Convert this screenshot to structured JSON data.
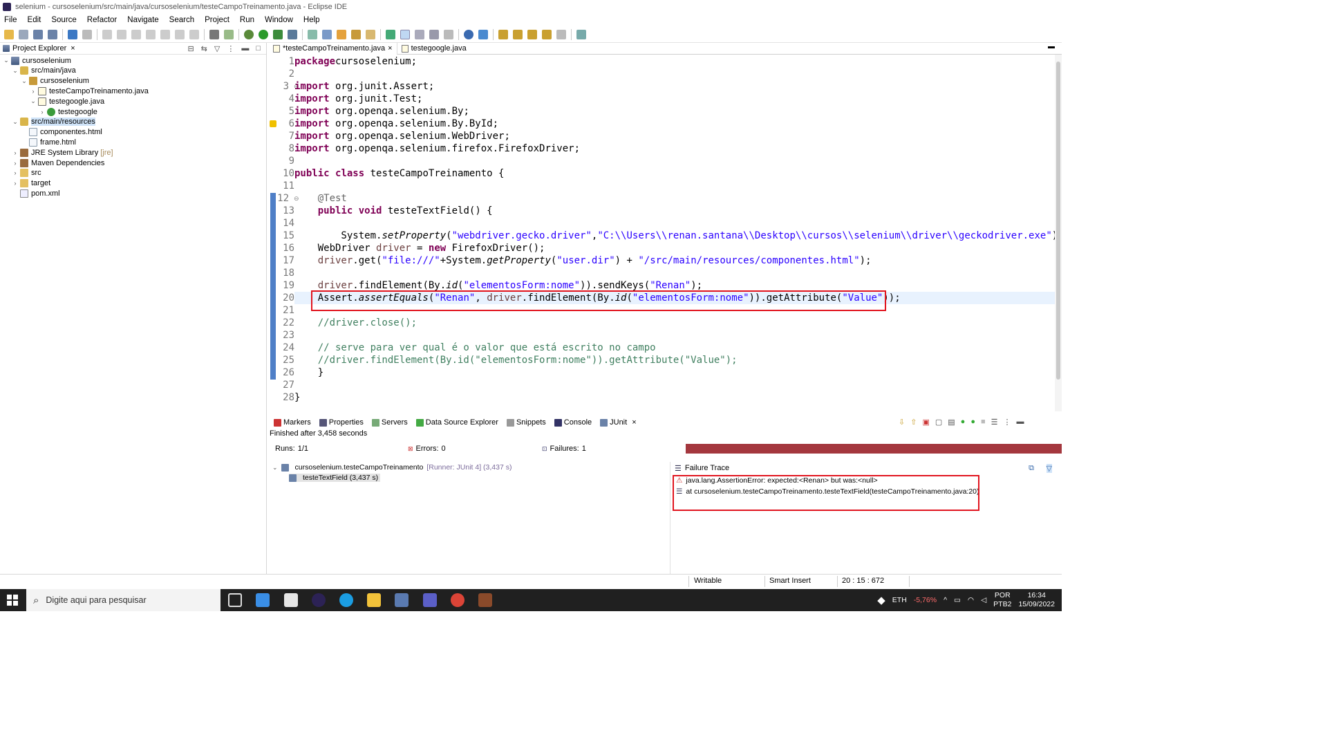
{
  "window": {
    "title": "selenium - cursoselenium/src/main/java/cursoselenium/testeCampoTreinamento.java - Eclipse IDE",
    "minimize": "—",
    "restore": "❐"
  },
  "menu": [
    "File",
    "Edit",
    "Source",
    "Refactor",
    "Navigate",
    "Search",
    "Project",
    "Run",
    "Window",
    "Help"
  ],
  "project_explorer": {
    "title": "Project Explorer",
    "items": [
      {
        "label": "cursoselenium",
        "depth": 0,
        "twisty": "⌄",
        "icon": "project-icon"
      },
      {
        "label": "src/main/java",
        "depth": 1,
        "twisty": "⌄",
        "icon": "source-folder-icon"
      },
      {
        "label": "cursoselenium",
        "depth": 2,
        "twisty": "⌄",
        "icon": "package-icon"
      },
      {
        "label": "testeCampoTreinamento.java",
        "depth": 3,
        "twisty": "›",
        "icon": "java-file-icon"
      },
      {
        "label": "testegoogle.java",
        "depth": 3,
        "twisty": "⌄",
        "icon": "java-file-icon"
      },
      {
        "label": "testegoogle",
        "depth": 4,
        "twisty": "›",
        "icon": "class-icon"
      },
      {
        "label": "src/main/resources",
        "depth": 1,
        "twisty": "⌄",
        "icon": "source-folder-icon",
        "selected": true
      },
      {
        "label": "componentes.html",
        "depth": 2,
        "twisty": "",
        "icon": "html-file-icon"
      },
      {
        "label": "frame.html",
        "depth": 2,
        "twisty": "",
        "icon": "html-file-icon"
      },
      {
        "label": "JRE System Library",
        "suffix": "[jre]",
        "depth": 1,
        "twisty": "›",
        "icon": "library-icon"
      },
      {
        "label": "Maven Dependencies",
        "depth": 1,
        "twisty": "›",
        "icon": "library-icon"
      },
      {
        "label": "src",
        "depth": 1,
        "twisty": "›",
        "icon": "folder-icon"
      },
      {
        "label": "target",
        "depth": 1,
        "twisty": "›",
        "icon": "folder-icon"
      },
      {
        "label": "pom.xml",
        "depth": 1,
        "twisty": "",
        "icon": "xml-file-icon"
      }
    ]
  },
  "editor": {
    "tabs": [
      {
        "label": "*testeCampoTreinamento.java",
        "active": true,
        "close": "×"
      },
      {
        "label": "testegoogle.java",
        "active": false
      }
    ],
    "lines": [
      {
        "n": "1",
        "html": [
          [
            "kw",
            "package"
          ],
          [
            "",
            "cursoselenium;"
          ]
        ]
      },
      {
        "n": "2",
        "html": []
      },
      {
        "n": "3",
        "html": [
          [
            "kw",
            "import"
          ],
          [
            "",
            " org.junit.Assert;"
          ]
        ],
        "fold": "⊖"
      },
      {
        "n": "4",
        "html": [
          [
            "kw",
            "import"
          ],
          [
            "",
            " org.junit.Test;"
          ]
        ]
      },
      {
        "n": "5",
        "html": [
          [
            "kw",
            "import"
          ],
          [
            "",
            " org.openqa.selenium.By;"
          ]
        ]
      },
      {
        "n": "6",
        "html": [
          [
            "kw",
            "import"
          ],
          [
            "",
            " org.openqa.selenium.By.ById;"
          ]
        ],
        "warn": true
      },
      {
        "n": "7",
        "html": [
          [
            "kw",
            "import"
          ],
          [
            "",
            " org.openqa.selenium.WebDriver;"
          ]
        ]
      },
      {
        "n": "8",
        "html": [
          [
            "kw",
            "import"
          ],
          [
            "",
            " org.openqa.selenium.firefox.FirefoxDriver;"
          ]
        ]
      },
      {
        "n": "9",
        "html": []
      },
      {
        "n": "10",
        "html": [
          [
            "kw",
            "public"
          ],
          [
            "",
            " "
          ],
          [
            "kw",
            "class"
          ],
          [
            "",
            " testeCampoTreinamento {"
          ]
        ]
      },
      {
        "n": "11",
        "html": []
      },
      {
        "n": "12",
        "html": [
          [
            "",
            "    "
          ],
          [
            "ann",
            "@Test"
          ]
        ],
        "fold": "⊖"
      },
      {
        "n": "13",
        "html": [
          [
            "",
            "    "
          ],
          [
            "kw",
            "public"
          ],
          [
            "",
            " "
          ],
          [
            "kw",
            "void"
          ],
          [
            "",
            " testeTextField() {"
          ]
        ]
      },
      {
        "n": "14",
        "html": []
      },
      {
        "n": "15",
        "html": [
          [
            "",
            "        System."
          ],
          [
            "it",
            "setProperty"
          ],
          [
            "",
            "("
          ],
          [
            "str",
            "\"webdriver.gecko.driver\""
          ],
          [
            "",
            ","
          ],
          [
            "str",
            "\"C:\\\\Users\\\\renan.santana\\\\Desktop\\\\cursos\\\\selenium\\\\driver\\\\geckodriver.exe\""
          ],
          [
            "",
            ");"
          ]
        ]
      },
      {
        "n": "16",
        "html": [
          [
            "",
            "    WebDriver "
          ],
          [
            "var",
            "driver"
          ],
          [
            "",
            " = "
          ],
          [
            "kw",
            "new"
          ],
          [
            "",
            " FirefoxDriver();"
          ]
        ]
      },
      {
        "n": "17",
        "html": [
          [
            "",
            "    "
          ],
          [
            "var",
            "driver"
          ],
          [
            "",
            ".get("
          ],
          [
            "str",
            "\"file:///\""
          ],
          [
            "",
            "+System."
          ],
          [
            "it",
            "getProperty"
          ],
          [
            "",
            "("
          ],
          [
            "str",
            "\"user.dir\""
          ],
          [
            "",
            ") + "
          ],
          [
            "str",
            "\"/src/main/resources/componentes.html\""
          ],
          [
            "",
            ");"
          ]
        ]
      },
      {
        "n": "18",
        "html": []
      },
      {
        "n": "19",
        "html": [
          [
            "",
            "    "
          ],
          [
            "var",
            "driver"
          ],
          [
            "",
            ".findElement(By."
          ],
          [
            "it",
            "id"
          ],
          [
            "",
            "("
          ],
          [
            "str",
            "\"elementosForm:nome\""
          ],
          [
            "",
            ")).sendKeys("
          ],
          [
            "str",
            "\"Renan\""
          ],
          [
            "",
            ");"
          ]
        ]
      },
      {
        "n": "20",
        "html": [
          [
            "",
            "    Assert."
          ],
          [
            "it",
            "assertEquals"
          ],
          [
            "",
            "("
          ],
          [
            "str",
            "\"Renan\""
          ],
          [
            "",
            ", "
          ],
          [
            "var",
            "driver"
          ],
          [
            "",
            ".findElement(By."
          ],
          [
            "it",
            "id"
          ],
          [
            "",
            "("
          ],
          [
            "str",
            "\"elementosForm:nome\""
          ],
          [
            "",
            ")).getAttribute("
          ],
          [
            "str",
            "\"Value\""
          ],
          [
            "",
            "));"
          ]
        ],
        "current": true
      },
      {
        "n": "21",
        "html": []
      },
      {
        "n": "22",
        "html": [
          [
            "",
            "    "
          ],
          [
            "cmt",
            "//driver.close();"
          ]
        ]
      },
      {
        "n": "23",
        "html": []
      },
      {
        "n": "24",
        "html": [
          [
            "",
            "    "
          ],
          [
            "cmt",
            "// serve para ver qual é o valor que está escrito no campo"
          ]
        ]
      },
      {
        "n": "25",
        "html": [
          [
            "",
            "    "
          ],
          [
            "cmt",
            "//driver.findElement(By.id(\"elementosForm:nome\")).getAttribute(\"Value\");"
          ]
        ]
      },
      {
        "n": "26",
        "html": [
          [
            "",
            "    }"
          ]
        ]
      },
      {
        "n": "27",
        "html": []
      },
      {
        "n": "28",
        "html": [
          [
            "",
            "}"
          ]
        ]
      }
    ]
  },
  "bottom_panel": {
    "tabs": [
      {
        "label": "Markers",
        "icon": "markers-icon"
      },
      {
        "label": "Properties",
        "icon": "properties-icon"
      },
      {
        "label": "Servers",
        "icon": "servers-icon"
      },
      {
        "label": "Data Source Explorer",
        "icon": "data-source-icon"
      },
      {
        "label": "Snippets",
        "icon": "snippets-icon"
      },
      {
        "label": "Console",
        "icon": "console-icon"
      },
      {
        "label": "JUnit",
        "icon": "junit-icon",
        "active": true,
        "close": "×"
      }
    ],
    "status": "Finished after 3,458 seconds",
    "runs_label": "Runs:",
    "runs_value": "1/1",
    "errors_label": "Errors:",
    "errors_value": "0",
    "failures_label": "Failures:",
    "failures_value": "1",
    "progress_failed_fraction": 1.0,
    "test_suite": "cursoselenium.testeCampoTreinamento",
    "test_suite_runner": "[Runner: JUnit 4] (3,437 s)",
    "test_case": "testeTextField (3,437 s)",
    "failure_trace_title": "Failure Trace",
    "trace": [
      "java.lang.AssertionError: expected:<Renan> but was:<null>",
      "at cursoselenium.testeCampoTreinamento.testeTextField(testeCampoTreinamento.java:20)"
    ]
  },
  "statusbar": {
    "writable": "Writable",
    "insert_mode": "Smart Insert",
    "position": "20 : 15 : 672"
  },
  "taskbar": {
    "search_placeholder": "Digite aqui para pesquisar",
    "eth_label": "ETH",
    "eth_change": "-5,76%",
    "lang": "POR",
    "layout": "PTB2",
    "time": "16:34",
    "date": "15/09/2022"
  },
  "colors": {
    "failure_bar": "#a4373e",
    "highlight_box": "#e1141e",
    "keyword": "#7f0055",
    "string": "#2a00ff",
    "comment": "#3f7f5f"
  }
}
